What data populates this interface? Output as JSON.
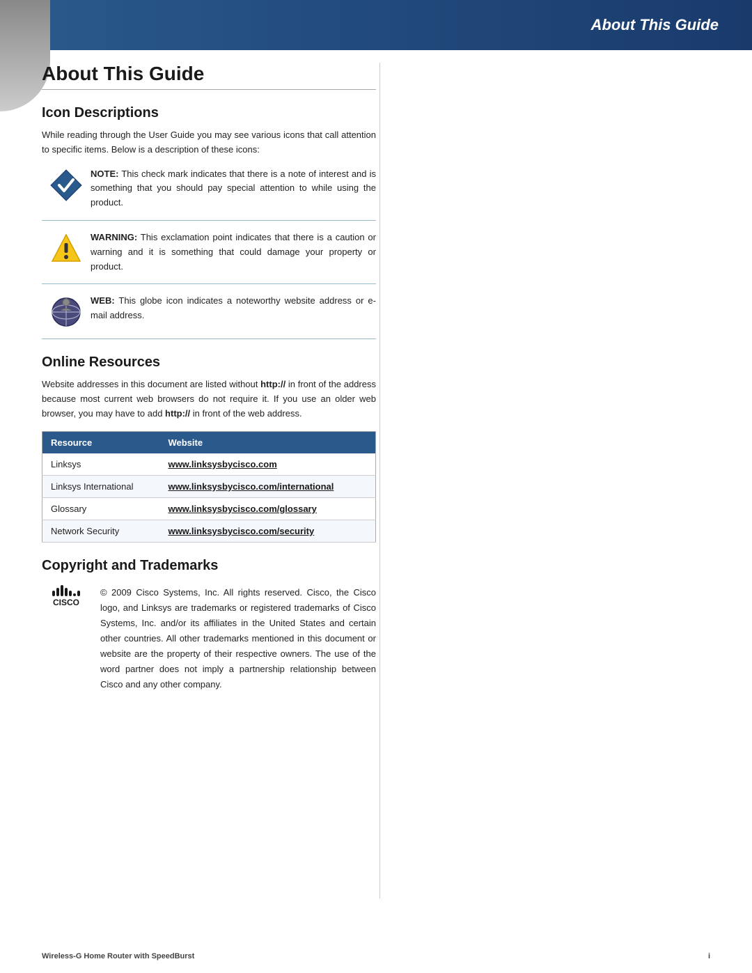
{
  "header": {
    "title": "About This Guide",
    "background_left": "#2a5a8c",
    "background_right": "#1a3a6c"
  },
  "page": {
    "title": "About This Guide",
    "sections": {
      "icon_descriptions": {
        "heading": "Icon Descriptions",
        "intro": "While reading through the User Guide you may see various icons that call attention to specific items. Below is a description of these icons:",
        "icons": [
          {
            "type": "note",
            "label": "NOTE:",
            "description": "This check mark indicates that there is a note of interest and is something that you should pay special attention to while using the product."
          },
          {
            "type": "warning",
            "label": "WARNING:",
            "description": "This exclamation point indicates that there is a caution or warning and it is something that could damage your property or product."
          },
          {
            "type": "web",
            "label": "WEB:",
            "description": "This globe icon indicates a noteworthy website address or e-mail address."
          }
        ]
      },
      "online_resources": {
        "heading": "Online Resources",
        "intro": "Website addresses in this document are listed without http:// in front of the address because most current web browsers do not require it. If you use an older web browser, you may have to add http:// in front of the web address.",
        "intro_bold1": "http://",
        "intro_bold2": "http://",
        "table": {
          "headers": [
            "Resource",
            "Website"
          ],
          "rows": [
            {
              "resource": "Linksys",
              "website": "www.linksysbycisco.com"
            },
            {
              "resource": "Linksys International",
              "website": "www.linksysbycisco.com/international"
            },
            {
              "resource": "Glossary",
              "website": "www.linksysbycisco.com/glossary"
            },
            {
              "resource": "Network Security",
              "website": "www.linksysbycisco.com/security"
            }
          ]
        }
      },
      "copyright": {
        "heading": "Copyright and Trademarks",
        "text": "© 2009 Cisco Systems, Inc. All rights reserved. Cisco, the Cisco logo, and Linksys are trademarks or registered trademarks of Cisco Systems, Inc. and/or its affiliates in the United States and certain other countries. All other trademarks mentioned in this document or website are the property of their respective owners. The use of the word partner does not imply a partnership relationship between Cisco and any other company.",
        "cisco_label": "CISCO"
      }
    },
    "footer": {
      "left": "Wireless-G Home Router with SpeedBurst",
      "right": "i"
    }
  }
}
